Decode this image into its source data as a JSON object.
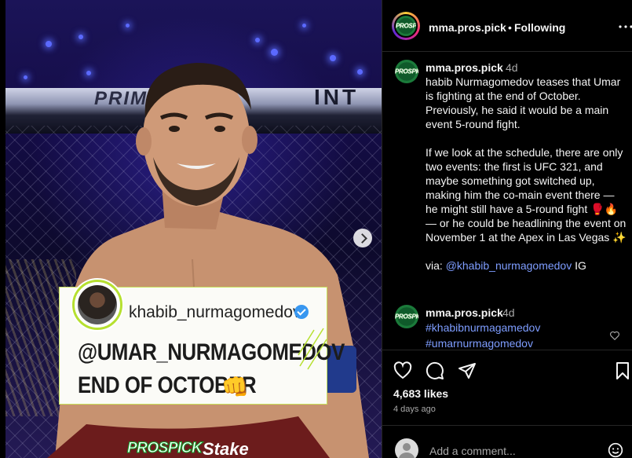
{
  "post": {
    "image_alt": "UFC fighter in octagon with quote card",
    "cage_banner": "PRIME",
    "cage_banner2": "INT",
    "quote": {
      "handle": "khabib_nurmagomedov",
      "line1": "@UMAR_NURMAGOMEDOV",
      "line2": "END OF OCTOBER",
      "emoji": "👊"
    },
    "brand_left": "PROSPICK",
    "brand_right": "Stake",
    "logo_text": "PROSPICK"
  },
  "header": {
    "username": "mma.pros.pick",
    "dot": "•",
    "follow_label": "Following"
  },
  "caption": {
    "username": "mma.pros.pick",
    "time": "4d",
    "paragraph1": "habib Nurmagomedov teases that Umar is fighting at the end of October. Previously, he said it would be a main event 5-round fight.",
    "paragraph2": "If we look at the schedule, there are only two events: the first is UFC 321, and maybe something got switched up, making him the co-main event there — he might still have a 5-round fight 🥊🔥 — or he could be headlining the event on November 1 at the Apex in Las Vegas ✨",
    "via_prefix": "via: ",
    "via_mention": "@khabib_nurmagomedov",
    "via_suffix": " IG"
  },
  "comment": {
    "username": "mma.pros.pick",
    "time": "4d",
    "tag1": "#khabibnurmagamedov",
    "tag2": "#umarnurmagomedov"
  },
  "actions": {
    "likes": "4,683 likes",
    "age": "4 days ago"
  },
  "add_comment": {
    "placeholder": "Add a comment..."
  },
  "colors": {
    "background": "#000000",
    "link": "#7e9dff",
    "muted": "#a8a8a8",
    "brand_green": "#1b7a3a",
    "card_accent": "#b6e030"
  }
}
